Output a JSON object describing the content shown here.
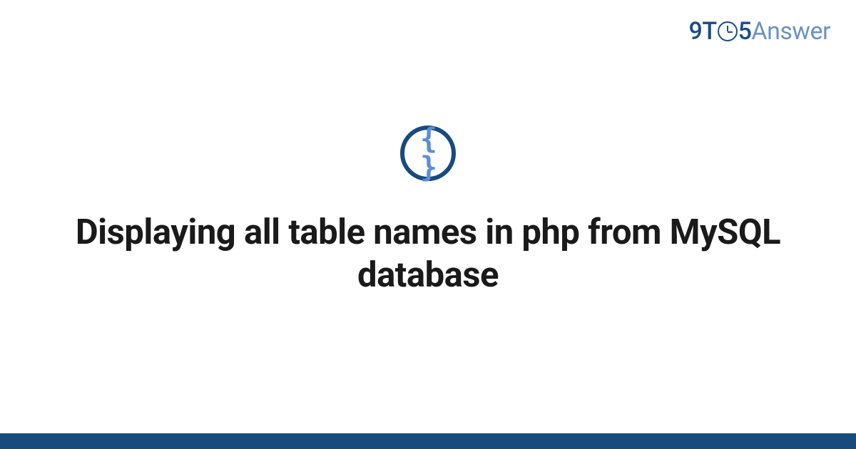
{
  "logo": {
    "part1": "9T",
    "part2": "5",
    "part3": "Answer"
  },
  "icon": {
    "glyph": "{ }"
  },
  "title": "Displaying all table names in php from MySQL database",
  "colors": {
    "brand_dark": "#184a7e",
    "brand_light": "#6b92c4",
    "icon_inner": "#5b8dd6"
  }
}
